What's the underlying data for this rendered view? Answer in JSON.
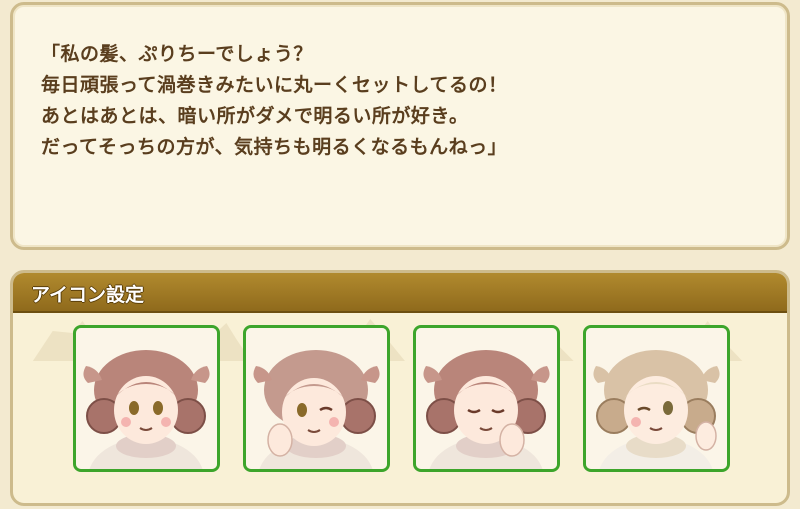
{
  "quote": {
    "lines": [
      "「私の髪、ぷりちーでしょう？",
      "毎日頑張って渦巻きみたいに丸ーくセットしてるの！",
      "あとはあとは、暗い所がダメで明るい所が好き。",
      "だってそっちの方が、気持ちも明るくなるもんねっ」"
    ]
  },
  "icon_settings": {
    "title": "アイコン設定",
    "icons": [
      {
        "icon": "sheep-portrait-smile-icon"
      },
      {
        "icon": "sheep-portrait-wink-icon"
      },
      {
        "icon": "sheep-portrait-eyes-closed-icon"
      },
      {
        "icon": "sheep-portrait-light-wink-icon"
      }
    ]
  },
  "colors": {
    "panel_border": "#cdbb8c",
    "header_bar": "#a27c26",
    "tile_border": "#3da52b",
    "text": "#5a3e1e"
  }
}
